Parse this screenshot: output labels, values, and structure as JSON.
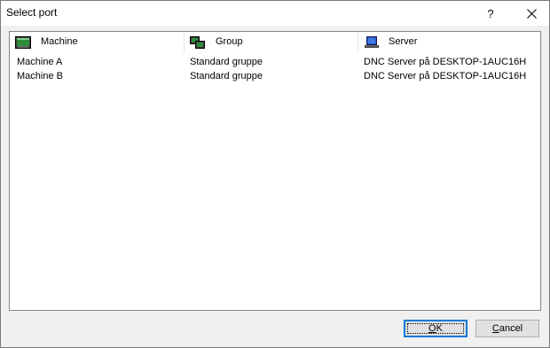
{
  "window": {
    "title": "Select port",
    "help_label": "?"
  },
  "columns": [
    {
      "label": "Machine",
      "icon": "machine-icon"
    },
    {
      "label": "Group",
      "icon": "group-icon"
    },
    {
      "label": "Server",
      "icon": "server-icon"
    }
  ],
  "rows": [
    {
      "machine": "Machine A",
      "group": "Standard gruppe",
      "server": "DNC Server på DESKTOP-1AUC16H"
    },
    {
      "machine": "Machine B",
      "group": "Standard gruppe",
      "server": "DNC Server på DESKTOP-1AUC16H"
    }
  ],
  "buttons": {
    "ok_mnemonic": "O",
    "ok_rest": "K",
    "cancel_mnemonic": "C",
    "cancel_rest": "ancel"
  },
  "colors": {
    "accent": "#0078d7",
    "machine_icon": "#2e8b3c"
  }
}
